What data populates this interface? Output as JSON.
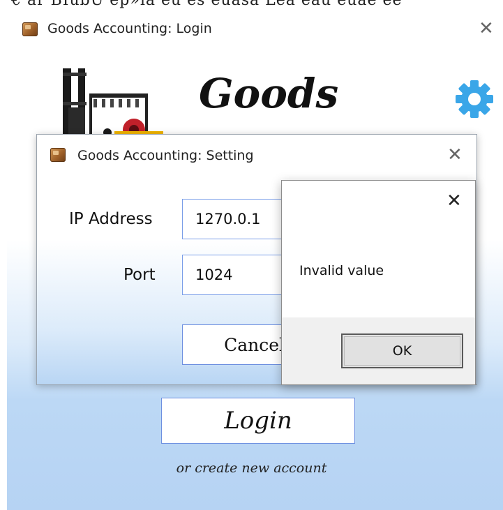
{
  "background_text": "€ ar BIübU ep»ıà eu eš euäsâ Lea eàu euäe eé",
  "login_window": {
    "title": "Goods Accounting: Login",
    "brand": "Goods",
    "login_label": "Login",
    "create_account_label": "or create new account"
  },
  "settings_dialog": {
    "title": "Goods Accounting: Setting",
    "ip_label": "IP Address",
    "ip_value": "1270.0.1",
    "port_label": "Port",
    "port_value": "1024",
    "cancel_label": "Cancel"
  },
  "message_box": {
    "message": "Invalid value",
    "ok_label": "OK"
  },
  "icons": {
    "close": "close-icon",
    "app": "app-icon",
    "gear": "gear-icon",
    "forklift": "forklift-logo"
  },
  "colors": {
    "gradient_blue": "#b6d3f3",
    "gear_blue": "#3aa6e8",
    "input_border": "#7a9ee8",
    "forklift_yellow": "#f0b400",
    "forklift_red": "#c0202a"
  }
}
